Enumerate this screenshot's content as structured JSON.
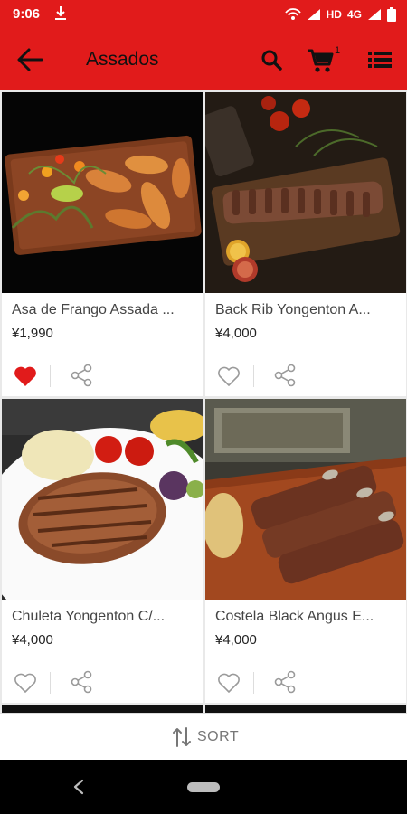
{
  "status_bar": {
    "time": "9:06",
    "network": "HD",
    "network_type": "4G"
  },
  "app_bar": {
    "title": "Assados",
    "cart_count": "1"
  },
  "products": [
    {
      "name": "Asa de Frango Assada ...",
      "price": "¥1,990",
      "favorited": true
    },
    {
      "name": "Back Rib Yongenton A...",
      "price": "¥4,000",
      "favorited": false
    },
    {
      "name": "Chuleta Yongenton C/...",
      "price": "¥4,000",
      "favorited": false
    },
    {
      "name": "Costela Black Angus E...",
      "price": "¥4,000",
      "favorited": false
    }
  ],
  "sort": {
    "label": "SORT"
  },
  "colors": {
    "primary": "#e11b1b",
    "heart_active": "#e11b1b",
    "icon_gray": "#9a9a9a"
  }
}
